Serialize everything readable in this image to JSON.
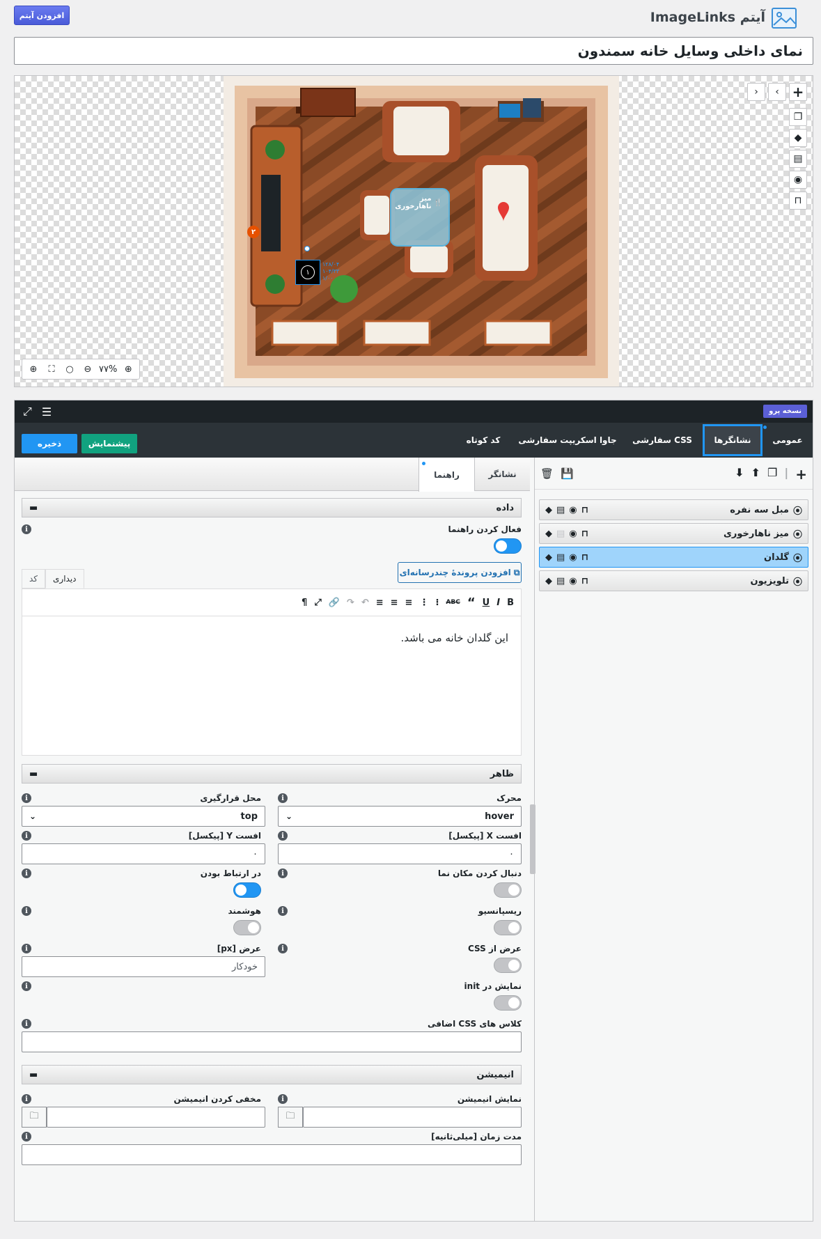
{
  "header": {
    "title": "آیتم ImageLinks",
    "add_item_label": "افزودن آیتم",
    "item_title": "نمای داخلی وسایل خانه سمندون"
  },
  "canvas": {
    "zoom_label": "۷۷%",
    "marker_tooltip": "میز ناهارخوری",
    "badge_one": "۱",
    "badge_two": "۲",
    "coords": [
      "۱۲۸/۰۴",
      "۱۰۴/۳۳",
      "۱/۰۰"
    ]
  },
  "topbar": {
    "pro_badge": "نسخه پرو"
  },
  "main_tabs": [
    {
      "label": "عمومی"
    },
    {
      "label": "نشانگرها"
    },
    {
      "label": "CSS سفارشی"
    },
    {
      "label": "جاوا اسکریپت سفارشی"
    },
    {
      "label": "کد کوتاه"
    }
  ],
  "actions": {
    "preview_label": "پیشنمایش",
    "save_label": "ذخیره"
  },
  "markers": [
    {
      "name": "مبل سه نفره"
    },
    {
      "name": "میز ناهارخوری"
    },
    {
      "name": "گلدان",
      "selected": true
    },
    {
      "name": "تلویزیون"
    }
  ],
  "sub_tabs": {
    "marker": "نشانگر",
    "guide": "راهنما"
  },
  "data_section": {
    "title": "داده",
    "enable_guide_label": "فعال کردن راهنما",
    "add_media_label": "افزودن پروندهٔ چندرسانه‌ای",
    "tab_visual": "دیداری",
    "tab_code": "کد",
    "content": "این گلدان خانه می باشد."
  },
  "appearance": {
    "title": "ظاهر",
    "trigger_label": "محرک",
    "trigger_value": "hover",
    "placement_label": "محل قرارگیری",
    "placement_value": "top",
    "offset_x_label": "افست X [پیکسل]",
    "offset_x_value": "۰",
    "offset_y_label": "افست Y [پیکسل]",
    "offset_y_value": "۰",
    "follow_cursor_label": "دنبال کردن مکان نما",
    "interactive_label": "در ارتباط بودن",
    "responsive_label": "ریسپانسیو",
    "smart_label": "هوشمند",
    "css_width_label": "عرض از CSS",
    "width_label": "عرض [px]",
    "width_value": "خودکار",
    "show_init_label": "نمایش در init",
    "extra_css_label": "کلاس های CSS اضافی"
  },
  "animation": {
    "title": "انیمیشن",
    "show_label": "نمایش انیمیشن",
    "hide_label": "مخفی کردن انیمیشن",
    "duration_label": "مدت زمان [میلی‌ثانیه]"
  },
  "colors": {
    "accent": "#2196f3",
    "preview": "#11a27f",
    "floor": "#8a4a26"
  }
}
